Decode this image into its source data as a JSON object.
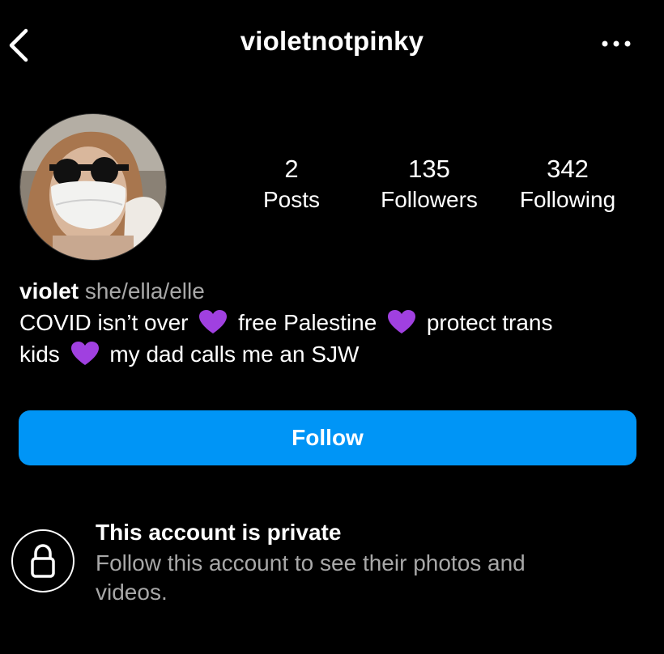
{
  "header": {
    "username": "violetnotpinky",
    "back_icon": "chevron-left-icon",
    "more_icon": "more-horizontal-icon"
  },
  "profile": {
    "avatar_icon": "profile-photo",
    "stats": [
      {
        "value": "2",
        "label": "Posts"
      },
      {
        "value": "135",
        "label": "Followers"
      },
      {
        "value": "342",
        "label": "Following"
      }
    ]
  },
  "bio": {
    "name": "violet",
    "pronouns": "she/ella/elle",
    "segments": [
      "COVID isn’t over",
      "free Palestine",
      "protect trans",
      "kids",
      "my dad calls me an SJW"
    ],
    "heart_color": "#a040e0"
  },
  "actions": {
    "follow_label": "Follow",
    "accent": "#0095f6"
  },
  "private_notice": {
    "title": "This account is private",
    "subtitle": "Follow this account to see their photos and videos.",
    "icon": "lock-icon"
  }
}
